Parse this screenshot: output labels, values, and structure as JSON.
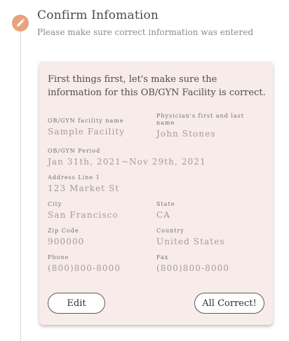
{
  "step": {
    "icon": "pencil-icon",
    "title": "Confirm Infomation",
    "subtitle": "Please make sure correct information was entered"
  },
  "card": {
    "intro": "First things first, let's make sure the information for this OB/GYN Facility is correct.",
    "fields": {
      "facility_name": {
        "label": "OB/GYN facility name",
        "value": "Sample Facility"
      },
      "physician": {
        "label": "Physician's first and last name",
        "value": "John Stones"
      },
      "period": {
        "label": "OB/GYN Period",
        "value": "Jan 31th, 2021~Nov 29th, 2021"
      },
      "address": {
        "label": "Address Line 1",
        "value": "123 Market St"
      },
      "city": {
        "label": "City",
        "value": "San Francisco"
      },
      "state": {
        "label": "State",
        "value": "CA"
      },
      "zip": {
        "label": "Zip Code",
        "value": "900000"
      },
      "country": {
        "label": "Country",
        "value": "United States"
      },
      "phone": {
        "label": "Phone",
        "value": "(800)800-8000"
      },
      "fax": {
        "label": "Fax",
        "value": "(800)800-8000"
      }
    },
    "buttons": {
      "edit": "Edit",
      "confirm": "All Correct!"
    }
  },
  "colors": {
    "accent": "#e8a27c",
    "card_background": "#f7ece9"
  }
}
